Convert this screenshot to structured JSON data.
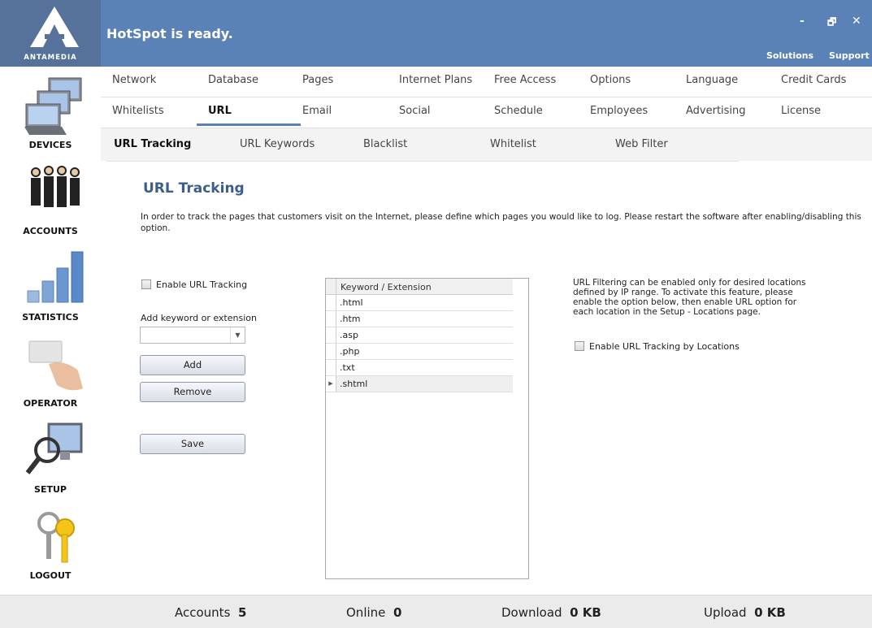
{
  "app": {
    "logo_text": "ANTAMEDIA",
    "status_title": "HotSpot is ready.",
    "window_controls": {
      "minimize": "-",
      "restore": "🗗",
      "close": "✕"
    },
    "top_links": [
      "Solutions",
      "Support"
    ]
  },
  "sidebar": {
    "items": [
      {
        "label": "DEVICES",
        "icon": "devices-icon"
      },
      {
        "label": "ACCOUNTS",
        "icon": "accounts-icon"
      },
      {
        "label": "STATISTICS",
        "icon": "statistics-icon"
      },
      {
        "label": "OPERATOR",
        "icon": "operator-icon"
      },
      {
        "label": "SETUP",
        "icon": "setup-icon"
      },
      {
        "label": "LOGOUT",
        "icon": "logout-icon"
      }
    ]
  },
  "tabs": {
    "row1": [
      "Network",
      "Database",
      "Pages",
      "Internet Plans",
      "Free Access",
      "Options",
      "Language",
      "Credit Cards"
    ],
    "row2": [
      "Whitelists",
      "URL",
      "Email",
      "Social",
      "Schedule",
      "Employees",
      "Advertising",
      "License"
    ],
    "active": "URL"
  },
  "subtabs": {
    "items": [
      "URL Tracking",
      "URL Keywords",
      "Blacklist",
      "Whitelist",
      "Web Filter"
    ],
    "active": "URL Tracking"
  },
  "content": {
    "title": "URL Tracking",
    "description": "In order to track the pages that customers visit on the Internet, please define which pages you would like to log.  Please restart the software after enabling/disabling this option.",
    "enable_label": "Enable URL Tracking",
    "enable_checked": false,
    "add_label": "Add keyword or extension",
    "combo_value": "",
    "buttons": {
      "add": "Add",
      "remove": "Remove",
      "save": "Save"
    },
    "grid": {
      "column": "Keyword / Extension",
      "rows": [
        ".html",
        ".htm",
        ".asp",
        ".php",
        ".txt",
        ".shtml"
      ],
      "selected_row": ".shtml"
    },
    "locations_note": "URL Filtering can be enabled only for desired locations defined by IP range.  To activate this feature, please enable the option below, then enable URL option for each location in the Setup - Locations page.",
    "locations_label": "Enable URL Tracking by Locations",
    "locations_checked": false
  },
  "statusbar": {
    "accounts_label": "Accounts",
    "accounts_value": "5",
    "online_label": "Online",
    "online_value": "0",
    "download_label": "Download",
    "download_value": "0 KB",
    "upload_label": "Upload",
    "upload_value": "0 KB"
  }
}
